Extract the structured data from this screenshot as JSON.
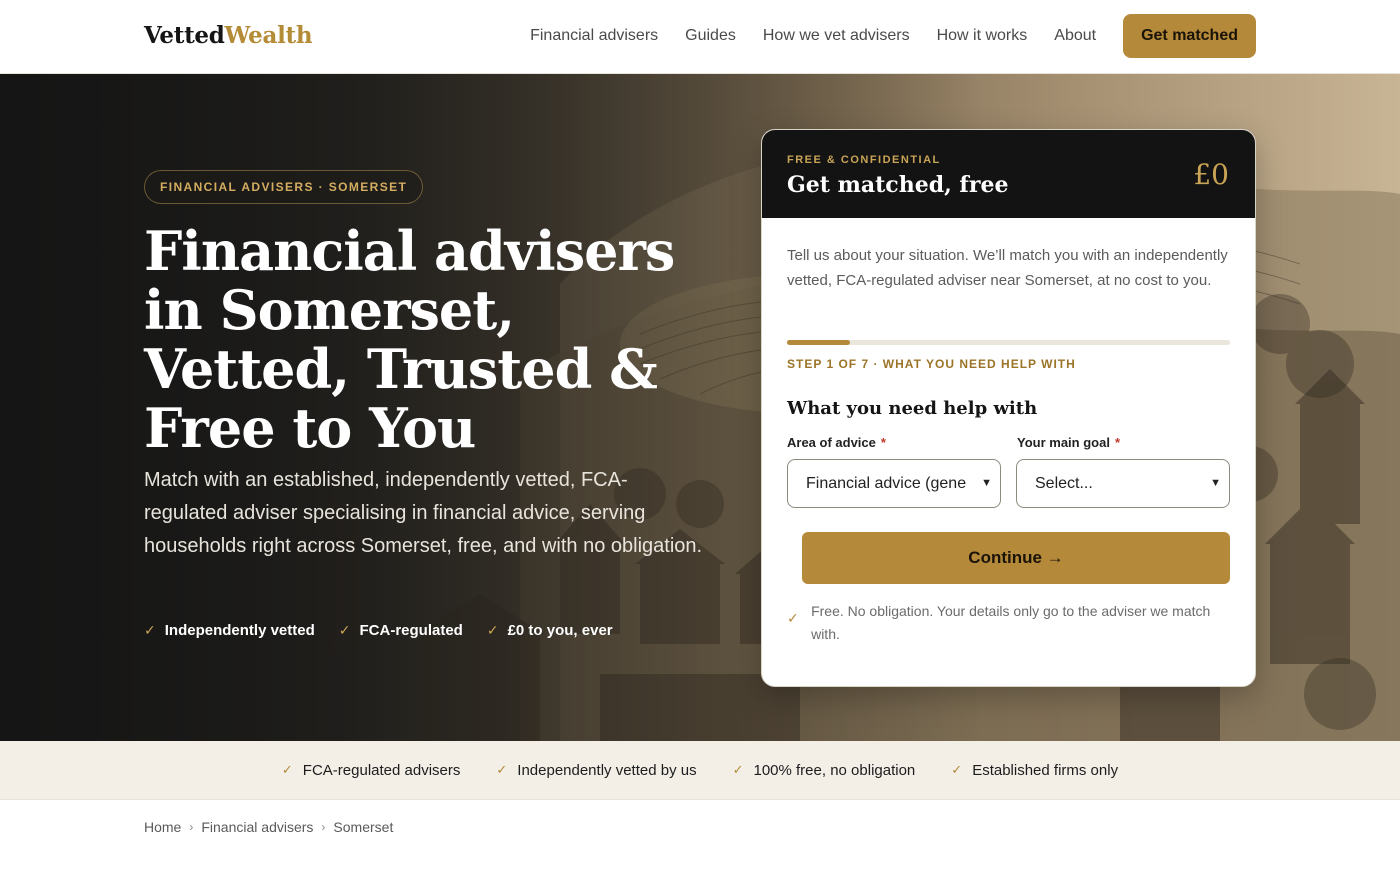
{
  "brand": {
    "name_part1": "Vetted",
    "name_part2": "Wealth"
  },
  "nav": {
    "items": [
      {
        "label": "Financial advisers"
      },
      {
        "label": "Guides"
      },
      {
        "label": "How we vet advisers"
      },
      {
        "label": "How it works"
      },
      {
        "label": "About"
      }
    ],
    "cta_label": "Get matched"
  },
  "hero": {
    "badge": "FINANCIAL ADVISERS · SOMERSET",
    "title": "Financial advisers in Somerset, Vetted, Trusted & Free to You",
    "subtitle": "Match with an established, independently vetted, FCA-regulated adviser specialising in financial advice, serving households right across Somerset, free, and with no obligation.",
    "checks": [
      "Independently vetted",
      "FCA-regulated",
      "£0 to you, ever"
    ]
  },
  "card": {
    "eyebrow": "FREE & CONFIDENTIAL",
    "title": "Get matched, free",
    "price": "£0",
    "intro": "Tell us about your situation. We’ll match you with an independently vetted, FCA-regulated adviser near Somerset, at no cost to you.",
    "progress_fraction": 0.143,
    "step_label": "STEP 1 OF 7 · WHAT YOU NEED HELP WITH",
    "section_title": "What you need help with",
    "fields": {
      "area_label": "Area of advice",
      "area_value": "Financial advice (gene",
      "goal_label": "Your main goal",
      "goal_value": "Select...",
      "required_mark": "*"
    },
    "continue_label": "Continue →",
    "note": "Free. No obligation. Your details only go to the adviser we match with."
  },
  "trust": [
    "FCA-regulated advisers",
    "Independently vetted by us",
    "100% free, no obligation",
    "Established firms only"
  ],
  "breadcrumb": [
    "Home",
    "Financial advisers",
    "Somerset"
  ],
  "colors": {
    "accent": "#b4893a",
    "dark": "#131313",
    "gold_text": "#c9a456",
    "trust_bg": "#f3efe6"
  },
  "icons": {
    "check": "check-icon",
    "chevron": "chevron-down-icon",
    "crumb_sep": "chevron-right-icon"
  }
}
